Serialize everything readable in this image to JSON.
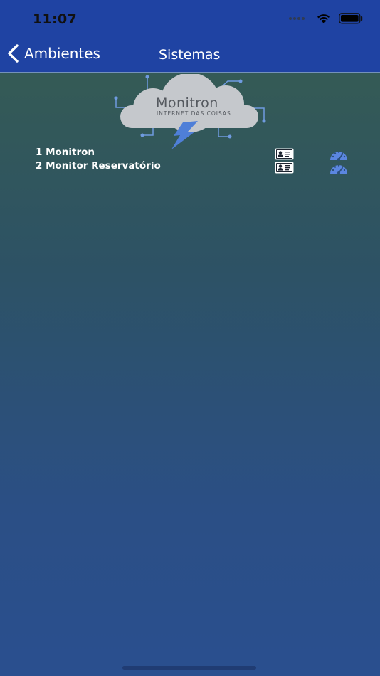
{
  "status_bar": {
    "time": "11:07"
  },
  "nav": {
    "back_label": "Ambientes",
    "title": "Sistemas"
  },
  "logo": {
    "title": "Monitron",
    "subtitle": "INTERNET DAS COISAS"
  },
  "items": [
    {
      "label": "1 Monitron"
    },
    {
      "label": "2 Monitor Reservatório"
    }
  ],
  "colors": {
    "nav_bg": "#1f43a3",
    "accent_gauge": "#5b86e0",
    "card_icon": "#ffffff",
    "text": "#ffffff"
  },
  "icons": [
    "wifi-icon",
    "battery-icon",
    "back-chevron-icon",
    "cloud-logo-icon",
    "contact-card-icon",
    "dashboard-gauge-icon"
  ]
}
